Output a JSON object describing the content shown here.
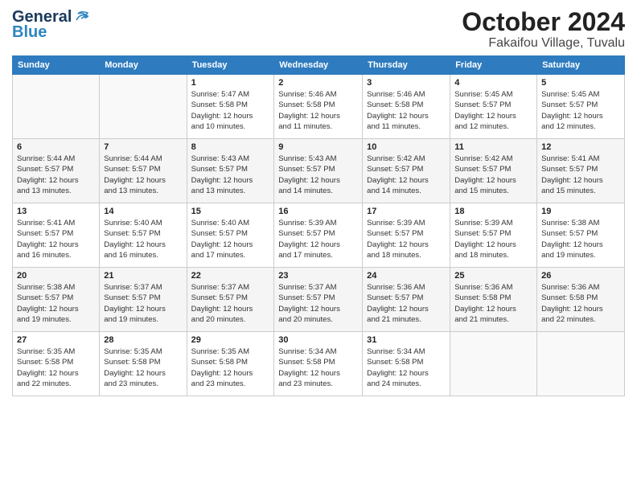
{
  "header": {
    "logo_general": "General",
    "logo_blue": "Blue",
    "month_title": "October 2024",
    "location": "Fakaifou Village, Tuvalu"
  },
  "days_of_week": [
    "Sunday",
    "Monday",
    "Tuesday",
    "Wednesday",
    "Thursday",
    "Friday",
    "Saturday"
  ],
  "weeks": [
    [
      {
        "day": "",
        "info": ""
      },
      {
        "day": "",
        "info": ""
      },
      {
        "day": "1",
        "info": "Sunrise: 5:47 AM\nSunset: 5:58 PM\nDaylight: 12 hours\nand 10 minutes."
      },
      {
        "day": "2",
        "info": "Sunrise: 5:46 AM\nSunset: 5:58 PM\nDaylight: 12 hours\nand 11 minutes."
      },
      {
        "day": "3",
        "info": "Sunrise: 5:46 AM\nSunset: 5:58 PM\nDaylight: 12 hours\nand 11 minutes."
      },
      {
        "day": "4",
        "info": "Sunrise: 5:45 AM\nSunset: 5:57 PM\nDaylight: 12 hours\nand 12 minutes."
      },
      {
        "day": "5",
        "info": "Sunrise: 5:45 AM\nSunset: 5:57 PM\nDaylight: 12 hours\nand 12 minutes."
      }
    ],
    [
      {
        "day": "6",
        "info": "Sunrise: 5:44 AM\nSunset: 5:57 PM\nDaylight: 12 hours\nand 13 minutes."
      },
      {
        "day": "7",
        "info": "Sunrise: 5:44 AM\nSunset: 5:57 PM\nDaylight: 12 hours\nand 13 minutes."
      },
      {
        "day": "8",
        "info": "Sunrise: 5:43 AM\nSunset: 5:57 PM\nDaylight: 12 hours\nand 13 minutes."
      },
      {
        "day": "9",
        "info": "Sunrise: 5:43 AM\nSunset: 5:57 PM\nDaylight: 12 hours\nand 14 minutes."
      },
      {
        "day": "10",
        "info": "Sunrise: 5:42 AM\nSunset: 5:57 PM\nDaylight: 12 hours\nand 14 minutes."
      },
      {
        "day": "11",
        "info": "Sunrise: 5:42 AM\nSunset: 5:57 PM\nDaylight: 12 hours\nand 15 minutes."
      },
      {
        "day": "12",
        "info": "Sunrise: 5:41 AM\nSunset: 5:57 PM\nDaylight: 12 hours\nand 15 minutes."
      }
    ],
    [
      {
        "day": "13",
        "info": "Sunrise: 5:41 AM\nSunset: 5:57 PM\nDaylight: 12 hours\nand 16 minutes."
      },
      {
        "day": "14",
        "info": "Sunrise: 5:40 AM\nSunset: 5:57 PM\nDaylight: 12 hours\nand 16 minutes."
      },
      {
        "day": "15",
        "info": "Sunrise: 5:40 AM\nSunset: 5:57 PM\nDaylight: 12 hours\nand 17 minutes."
      },
      {
        "day": "16",
        "info": "Sunrise: 5:39 AM\nSunset: 5:57 PM\nDaylight: 12 hours\nand 17 minutes."
      },
      {
        "day": "17",
        "info": "Sunrise: 5:39 AM\nSunset: 5:57 PM\nDaylight: 12 hours\nand 18 minutes."
      },
      {
        "day": "18",
        "info": "Sunrise: 5:39 AM\nSunset: 5:57 PM\nDaylight: 12 hours\nand 18 minutes."
      },
      {
        "day": "19",
        "info": "Sunrise: 5:38 AM\nSunset: 5:57 PM\nDaylight: 12 hours\nand 19 minutes."
      }
    ],
    [
      {
        "day": "20",
        "info": "Sunrise: 5:38 AM\nSunset: 5:57 PM\nDaylight: 12 hours\nand 19 minutes."
      },
      {
        "day": "21",
        "info": "Sunrise: 5:37 AM\nSunset: 5:57 PM\nDaylight: 12 hours\nand 19 minutes."
      },
      {
        "day": "22",
        "info": "Sunrise: 5:37 AM\nSunset: 5:57 PM\nDaylight: 12 hours\nand 20 minutes."
      },
      {
        "day": "23",
        "info": "Sunrise: 5:37 AM\nSunset: 5:57 PM\nDaylight: 12 hours\nand 20 minutes."
      },
      {
        "day": "24",
        "info": "Sunrise: 5:36 AM\nSunset: 5:57 PM\nDaylight: 12 hours\nand 21 minutes."
      },
      {
        "day": "25",
        "info": "Sunrise: 5:36 AM\nSunset: 5:58 PM\nDaylight: 12 hours\nand 21 minutes."
      },
      {
        "day": "26",
        "info": "Sunrise: 5:36 AM\nSunset: 5:58 PM\nDaylight: 12 hours\nand 22 minutes."
      }
    ],
    [
      {
        "day": "27",
        "info": "Sunrise: 5:35 AM\nSunset: 5:58 PM\nDaylight: 12 hours\nand 22 minutes."
      },
      {
        "day": "28",
        "info": "Sunrise: 5:35 AM\nSunset: 5:58 PM\nDaylight: 12 hours\nand 23 minutes."
      },
      {
        "day": "29",
        "info": "Sunrise: 5:35 AM\nSunset: 5:58 PM\nDaylight: 12 hours\nand 23 minutes."
      },
      {
        "day": "30",
        "info": "Sunrise: 5:34 AM\nSunset: 5:58 PM\nDaylight: 12 hours\nand 23 minutes."
      },
      {
        "day": "31",
        "info": "Sunrise: 5:34 AM\nSunset: 5:58 PM\nDaylight: 12 hours\nand 24 minutes."
      },
      {
        "day": "",
        "info": ""
      },
      {
        "day": "",
        "info": ""
      }
    ]
  ]
}
